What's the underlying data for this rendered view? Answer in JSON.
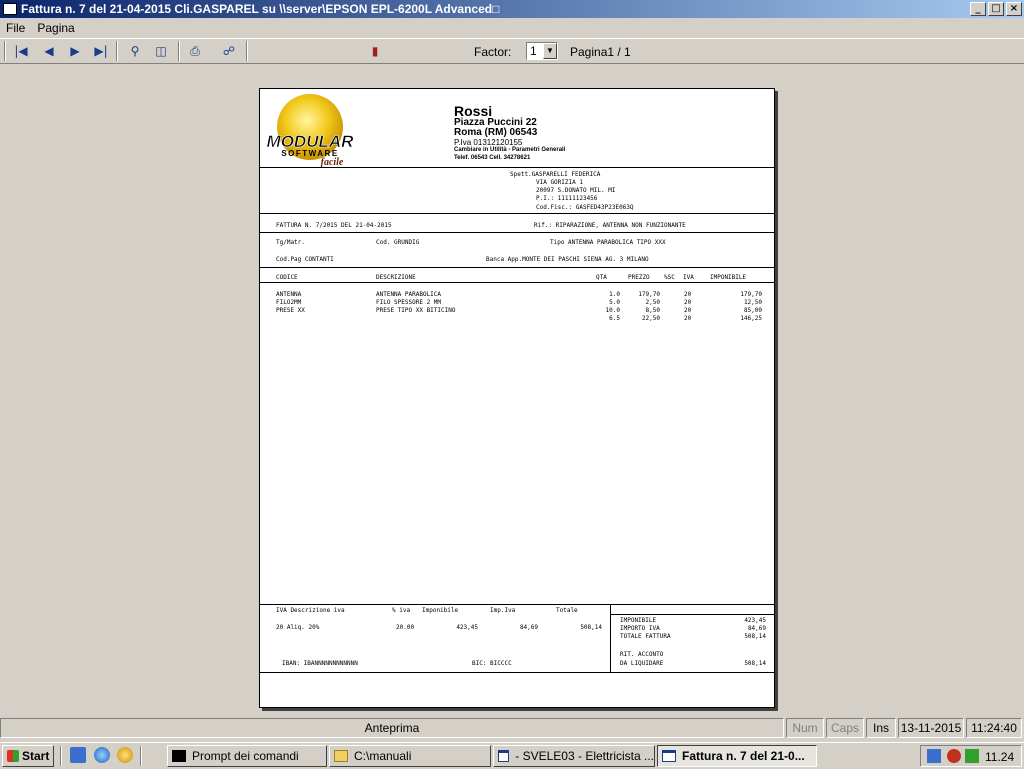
{
  "window": {
    "title": "Fattura n.   7 del 21-04-2015 Cli.GASPAREL su \\\\server\\EPSON EPL-6200L Advanced□",
    "minimize": "_",
    "maximize": "□",
    "close": "×"
  },
  "menu": {
    "file": "File",
    "pagina": "Pagina"
  },
  "toolbar": {
    "factor_label": "Factor:",
    "factor_value": "1",
    "page_label": "Pagina1 / 1"
  },
  "invoice": {
    "logo": {
      "word1": "MODULAR",
      "word2": "SOFTWARE",
      "word3": "facile"
    },
    "company": {
      "name": "Rossi",
      "address": "Piazza Puccini 22",
      "city": "Roma  (RM)  06543",
      "vat": "P.Iva 01312120155",
      "note": "Cambiare in Utilità - Parametri Generali",
      "phone": "Telef. 06543   Cell. 34278621"
    },
    "client": {
      "line1": "Spett.GASPARELLI FEDERICA",
      "line2": "VIA GORIZIA 1",
      "line3": "20097 S.DONATO MIL. MI",
      "line4": "P.I.: 11111123456",
      "line5": "Cod.Fisc.: GASFED43P23E063Q"
    },
    "header": {
      "fattura": "FATTURA  N.     7/2015 DEL 21-04-2015",
      "rif": "Rif.: RIPARAZIONE, ANTENNA NON FUNZIONANTE"
    },
    "info": {
      "tg_matr": "Tg/Matr.",
      "cod": "Cod. GRUNDIG",
      "tipo": "Tipo ANTENNA PARABOLICA TIPO XXX",
      "cod_pag": "Cod.Pag CONTANTI",
      "banca": "Banca App.MONTE DEI PASCHI SIENA   AG. 3   MILANO"
    },
    "columns": {
      "codice": "CODICE",
      "descrizione": "DESCRIZIONE",
      "qta": "QTA",
      "prezzo": "PREZZO",
      "sc": "%SC",
      "iva": "IVA",
      "imponibile": "IMPONIBILE"
    },
    "rows": [
      {
        "codice": "ANTENNA",
        "descrizione": "ANTENNA PARABOLICA",
        "qta": "1.0",
        "prezzo": "179,70",
        "iva": "20",
        "imponibile": "179,70"
      },
      {
        "codice": "FILO2MM",
        "descrizione": "FILO SPESSORE 2 MM",
        "qta": "5.0",
        "prezzo": "2,50",
        "iva": "20",
        "imponibile": "12,50"
      },
      {
        "codice": "PRESE XX",
        "descrizione": "PRESE TIPO XX BITICINO",
        "qta": "10.0",
        "prezzo": "8,50",
        "iva": "20",
        "imponibile": "85,00"
      },
      {
        "codice": "",
        "descrizione": "",
        "qta": "6.5",
        "prezzo": "22,50",
        "iva": "20",
        "imponibile": "146,25"
      }
    ],
    "footer": {
      "iva_header": {
        "iva_desc": "IVA Descrizione iva",
        "perc": "% iva",
        "imponibile": "Imponibile",
        "imp_iva": "Imp.Iva",
        "totale": "Totale"
      },
      "iva_row": {
        "aliq": "20  Aliq. 20%",
        "perc": "20.00",
        "imponibile": "423,45",
        "imp_iva": "84,69",
        "totale": "508,14"
      },
      "iban": "IBAN: IBANNNNNNNNNNNN",
      "bic": "BIC: BICCCC",
      "totals": {
        "imponibile_label": "IMPONIBILE",
        "imponibile": "423,45",
        "importo_iva_label": "IMPORTO IVA",
        "importo_iva": "84,69",
        "totale_label": "TOTALE FATTURA",
        "totale": "508,14",
        "rit_label": "RIT. ACCONTO",
        "liquidare_label": "DA LIQUIDARE",
        "liquidare": "508,14"
      }
    }
  },
  "status": {
    "mode": "Anteprima",
    "num": "Num",
    "caps": "Caps",
    "ins": "Ins",
    "date": "13-11-2015",
    "time": "11:24:40"
  },
  "taskbar": {
    "start": "Start",
    "tasks": [
      "Prompt dei comandi",
      "C:\\manuali",
      "- SVELE03 - Elettricista  ...",
      "Fattura n.   7 del 21-0..."
    ],
    "clock": "11.24"
  }
}
